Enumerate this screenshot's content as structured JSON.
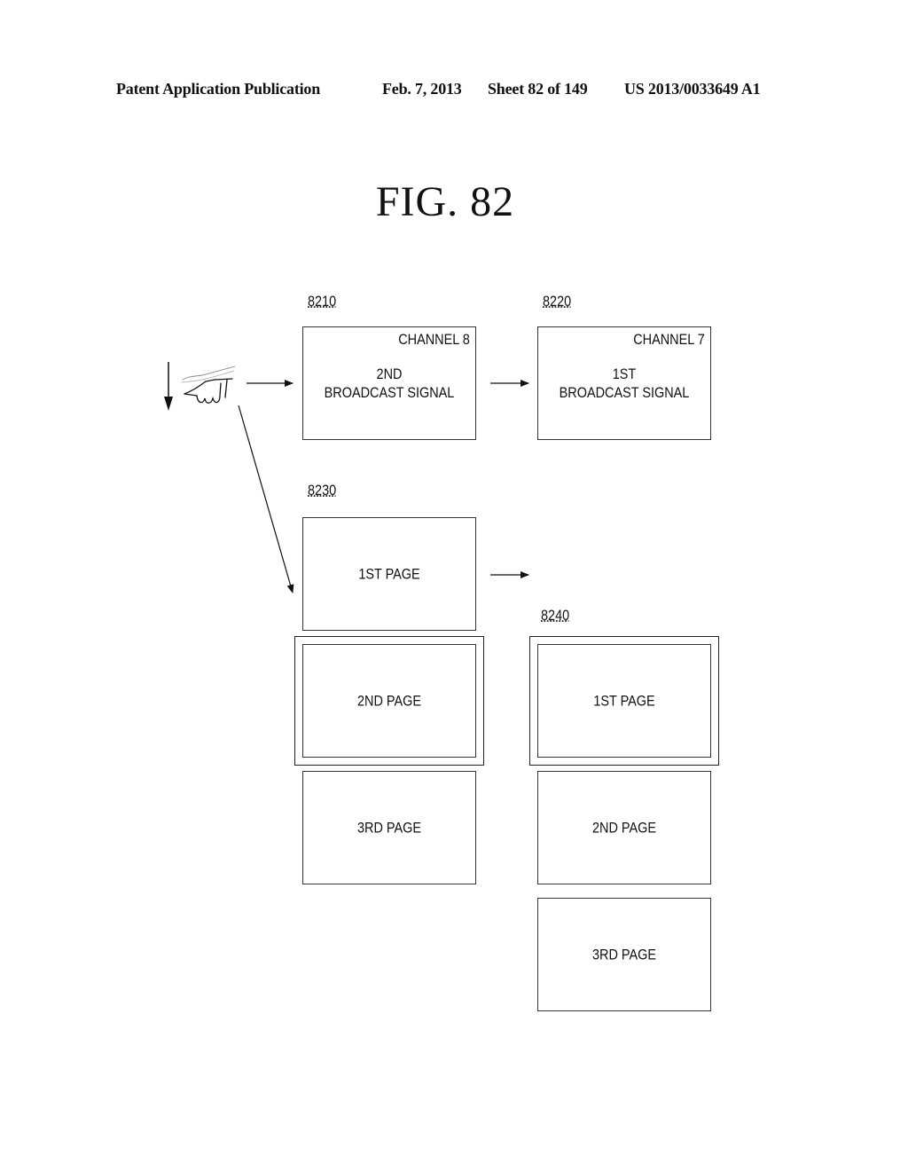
{
  "header": {
    "publication": "Patent Application Publication",
    "date": "Feb. 7, 2013",
    "sheet": "Sheet 82 of 149",
    "number": "US 2013/0033649 A1"
  },
  "figure": {
    "title": "FIG.  82"
  },
  "gesture": {
    "icon": "hand-swipe-down-icon",
    "direction_arrow": "arrow-down-icon"
  },
  "screens": {
    "s8210": {
      "ref": "8210",
      "channel": "CHANNEL 8",
      "line1": "2ND",
      "line2": "BROADCAST SIGNAL"
    },
    "s8220": {
      "ref": "8220",
      "channel": "CHANNEL 7",
      "line1": "1ST",
      "line2": "BROADCAST SIGNAL"
    },
    "s8230": {
      "ref": "8230",
      "pages": [
        "1ST PAGE",
        "2ND PAGE",
        "3RD PAGE"
      ],
      "selected_page": "2ND PAGE"
    },
    "s8240": {
      "ref": "8240",
      "pages": [
        "1ST PAGE",
        "2ND PAGE",
        "3RD PAGE"
      ],
      "selected_page": "1ST PAGE"
    }
  }
}
